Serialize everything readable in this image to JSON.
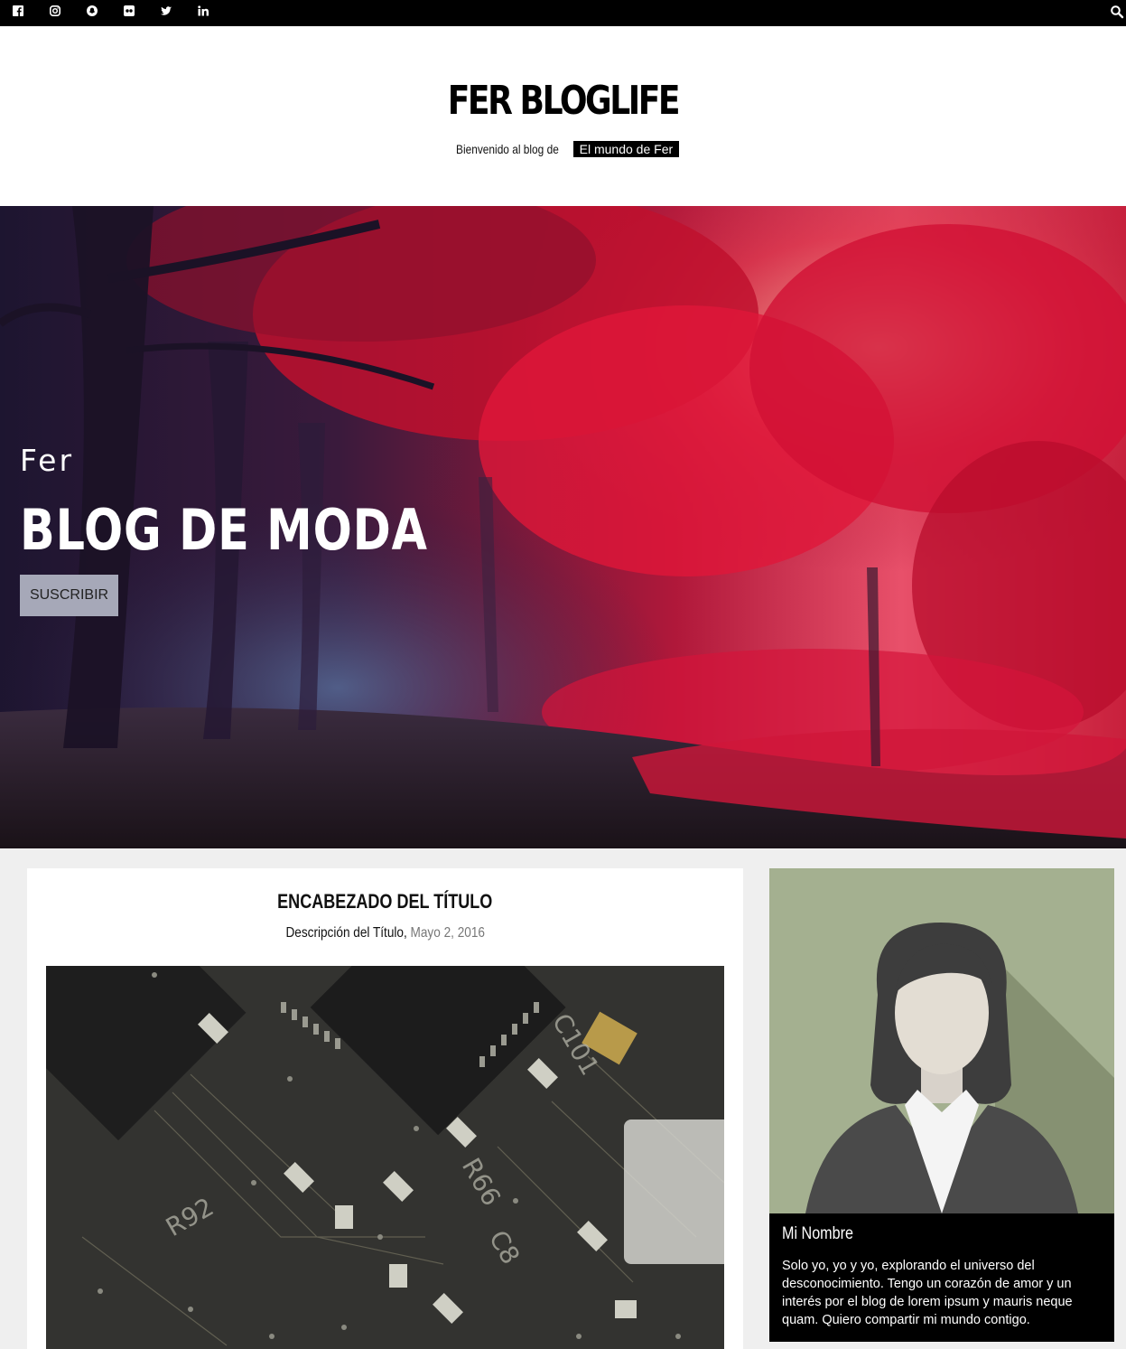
{
  "topbar": {
    "social_icons": [
      "facebook-icon",
      "instagram-icon",
      "snapchat-icon",
      "flickr-icon",
      "twitter-icon",
      "linkedin-icon"
    ],
    "search_icon": "search-icon"
  },
  "header": {
    "title": "FER BLOGLIFE",
    "tagline_text": "Bienvenido al blog de",
    "tagline_highlight": "El mundo de Fer"
  },
  "hero": {
    "subtitle": "Fer",
    "title": "BLOG DE MODA",
    "button_label": "SUSCRIBIR"
  },
  "post": {
    "title": "ENCABEZADO DEL TÍTULO",
    "description": "Descripción del Título,",
    "date": "Mayo 2, 2016"
  },
  "profile": {
    "name": "Mi Nombre",
    "bio": "Solo yo, yo y yo, explorando el universo del desconocimiento. Tengo un corazón de amor y un interés por el blog de lorem ipsum y mauris neque quam. Quiero compartir mi mundo contigo."
  },
  "colors": {
    "topbar": "#000000",
    "hero_button": "#a6a8b8",
    "content_bg": "#efefef",
    "avatar_bg": "#a4b090",
    "profile_bg": "#000000"
  }
}
